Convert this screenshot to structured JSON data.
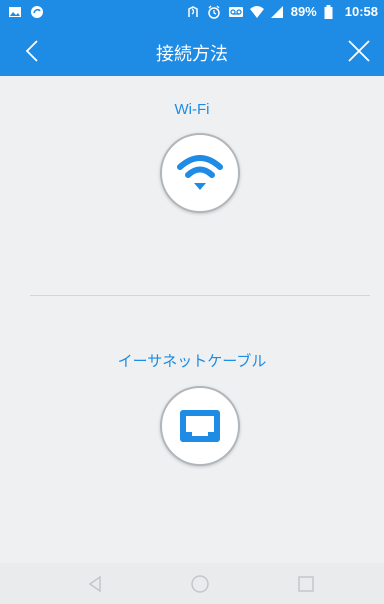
{
  "status_bar": {
    "battery": "89%",
    "time": "10:58",
    "left_icons": [
      "image-icon",
      "sync-icon"
    ],
    "right_icons": [
      "nfc-icon",
      "alarm-icon",
      "voicemail-icon",
      "wifi-icon",
      "signal-icon",
      "battery-icon"
    ]
  },
  "app_bar": {
    "title": "接続方法",
    "back_icon": "chevron-left-icon",
    "close_icon": "close-icon"
  },
  "options": [
    {
      "label": "Wi-Fi",
      "icon": "wifi-icon"
    },
    {
      "label": "イーサネットケーブル",
      "icon": "ethernet-icon"
    }
  ],
  "nav_bar": {
    "icons": [
      "back-triangle-icon",
      "home-circle-icon",
      "recents-square-icon"
    ]
  },
  "colors": {
    "accent": "#1e8be4",
    "background": "#eef0f1",
    "divider": "#d3d6d9"
  }
}
